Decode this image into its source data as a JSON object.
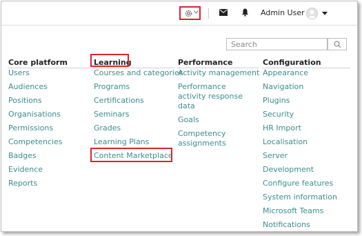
{
  "header": {
    "user_name": "Admin User",
    "icons": [
      "gear-icon",
      "chevron-down-icon",
      "mail-icon",
      "bell-icon",
      "user-avatar-icon",
      "caret-down-icon"
    ]
  },
  "search": {
    "placeholder": "Search",
    "button_icon": "search-icon"
  },
  "colors": {
    "link": "#3b8d8d",
    "highlight": "#d9242b",
    "text": "#222222"
  },
  "menu": {
    "core_platform": {
      "title": "Core platform",
      "items": [
        "Users",
        "Audiences",
        "Positions",
        "Organisations",
        "Permissions",
        "Competencies",
        "Badges",
        "Evidence",
        "Reports"
      ]
    },
    "learning": {
      "title": "Learning",
      "items": [
        "Courses and categories",
        "Programs",
        "Certifications",
        "Seminars",
        "Grades",
        "Learning Plans",
        "Content Marketplace"
      ]
    },
    "performance": {
      "title": "Performance",
      "items": [
        "Activity management",
        "Performance activity response data",
        "Goals",
        "Competency assignments"
      ]
    },
    "configuration": {
      "title": "Configuration",
      "items": [
        "Appearance",
        "Navigation",
        "Plugins",
        "Security",
        "HR Import",
        "Localisation",
        "Server",
        "Development",
        "Configure features",
        "System information",
        "Microsoft Teams",
        "Notifications"
      ]
    }
  }
}
